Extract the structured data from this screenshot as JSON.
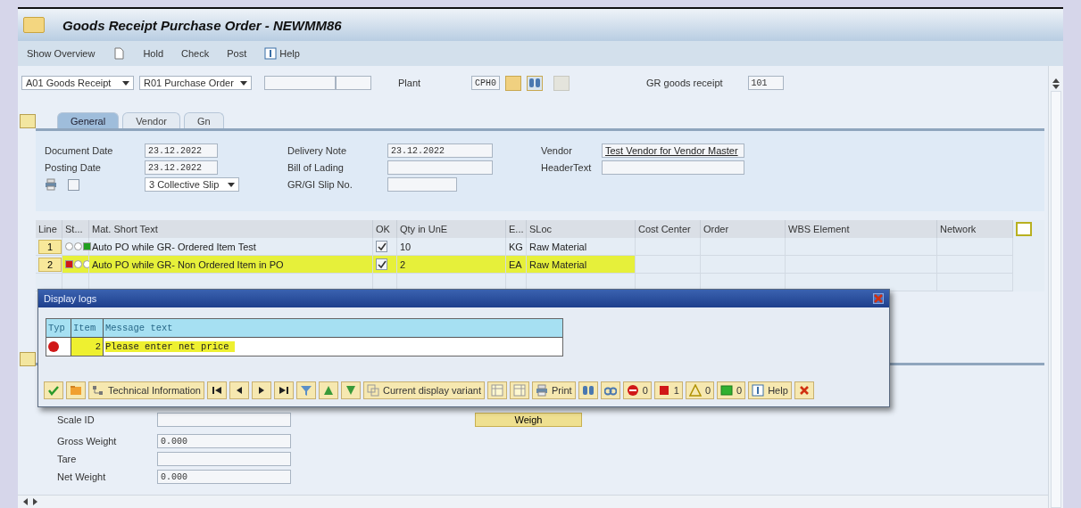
{
  "window": {
    "title": "Goods Receipt Purchase Order - NEWMM86"
  },
  "toolbar": [
    {
      "kind": "text",
      "label": "Show Overview"
    },
    {
      "kind": "page"
    },
    {
      "kind": "text",
      "label": "Hold"
    },
    {
      "kind": "text",
      "label": "Check"
    },
    {
      "kind": "text",
      "label": "Post"
    },
    {
      "kind": "help",
      "label": "Help"
    }
  ],
  "selection": {
    "action": "A01 Goods Receipt",
    "reference": "R01 Purchase Order",
    "plant_label": "Plant",
    "plant": "CPH0",
    "movement_label": "GR goods receipt",
    "movement_type": "101"
  },
  "tabs": [
    {
      "label": "General",
      "selected": true
    },
    {
      "label": "Vendor",
      "selected": false
    },
    {
      "label": "Gn",
      "selected": false
    }
  ],
  "header": {
    "left": [
      {
        "label": "Document Date",
        "value": "23.12.2022"
      },
      {
        "label": "Posting Date",
        "value": "23.12.2022"
      }
    ],
    "print_checked": false,
    "print_version": "3 Collective Slip",
    "middle": [
      {
        "label": "Delivery Note",
        "value": "23.12.2022"
      },
      {
        "label": "Bill of Lading"
      },
      {
        "label": "GR/GI Slip No."
      }
    ],
    "right": [
      {
        "label": "Vendor",
        "value": "Test Vendor for Vendor Master",
        "kind": "link"
      },
      {
        "label": "HeaderText",
        "kind": "field"
      }
    ]
  },
  "table": {
    "columns": [
      "Line",
      "St...",
      "Mat. Short Text",
      "OK",
      "Qty in UnE",
      "E...",
      "SLoc",
      "Cost Center",
      "Order",
      "WBS Element",
      "Network"
    ],
    "rows": [
      {
        "line": "1",
        "kind": "green",
        "text": "Auto PO while GR- Ordered Item Test",
        "ok": true,
        "qty": "10",
        "unit": "KG",
        "sloc": "Raw Material",
        "highlighted": false
      },
      {
        "line": "2",
        "kind": "red",
        "text": "Auto PO while GR- Non Ordered Item in PO",
        "ok": true,
        "qty": "2",
        "unit": "EA",
        "sloc": "Raw Material",
        "highlighted": true
      }
    ]
  },
  "weights": {
    "fields": [
      {
        "label": "Scale ID"
      },
      {
        "label": "Gross Weight",
        "value": "0.000"
      },
      {
        "label": "Tare"
      },
      {
        "label": "Net Weight",
        "value": "0.000"
      }
    ],
    "button": "Weigh"
  },
  "dialog": {
    "title": "Display logs",
    "columns": [
      "Typ",
      "Item",
      "Message text"
    ],
    "rows": [
      {
        "kind": "error",
        "item": "2",
        "text": "Please enter net price",
        "highlighted": true
      }
    ],
    "toolbar": [
      {
        "kind": "ok"
      },
      {
        "kind": "detail"
      },
      {
        "kind": "tech",
        "label": "Technical Information"
      },
      {
        "kind": "first"
      },
      {
        "kind": "prev"
      },
      {
        "kind": "next"
      },
      {
        "kind": "last"
      },
      {
        "kind": "filter"
      },
      {
        "kind": "sort-up"
      },
      {
        "kind": "sort-down"
      },
      {
        "kind": "variant",
        "label": "Current display variant"
      },
      {
        "kind": "layout"
      },
      {
        "kind": "layout-save"
      },
      {
        "kind": "print",
        "label": "Print"
      },
      {
        "kind": "find"
      },
      {
        "kind": "find-next"
      },
      {
        "kind": "stop",
        "label": "0"
      },
      {
        "kind": "error",
        "label": "1"
      },
      {
        "kind": "warning",
        "label": "0"
      },
      {
        "kind": "success",
        "label": "0"
      },
      {
        "kind": "help",
        "label": "Help"
      },
      {
        "kind": "close"
      }
    ]
  }
}
